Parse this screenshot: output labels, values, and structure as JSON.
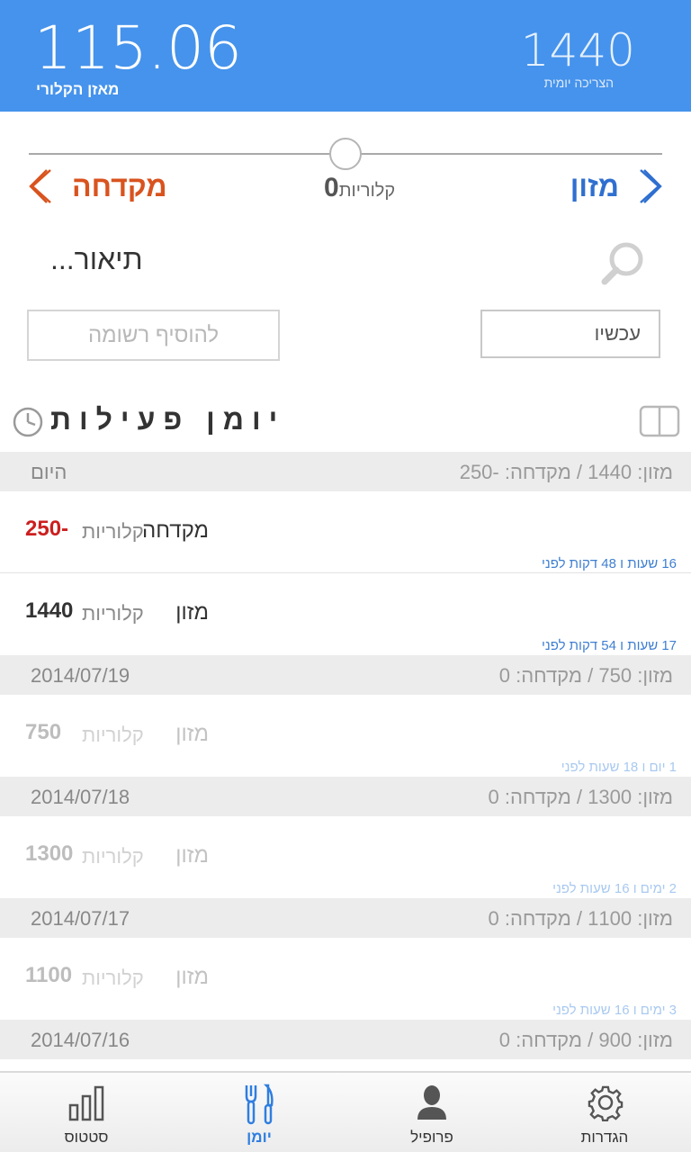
{
  "header": {
    "balance_value": "115.06",
    "balance_label": "מאזן הקלורי",
    "requirement_value": "1440",
    "requirement_label": "הצריכה יומית",
    "background_color": "#4593ec"
  },
  "entry_form": {
    "left_nav_label": "מקדחה",
    "right_nav_label": "מזון",
    "calories_value": "0",
    "calories_word": "קלוריות",
    "description_placeholder": "תיאור...",
    "add_note_label": "להוסיף רשומה",
    "time_value": "עכשיו"
  },
  "log": {
    "title": "יומן פעילות",
    "days": [
      {
        "summary": "מזון: 1440 / מקדחה: -250",
        "date": "היום",
        "entries": [
          {
            "type": "מקדחה",
            "cal_word": "קלוריות",
            "cal_value": "250-",
            "ago": "16 שעות ו 48 דקות לפני"
          },
          {
            "type": "מזון",
            "cal_word": "קלוריות",
            "cal_value": "1440",
            "ago": "17 שעות ו 54 דקות לפני"
          }
        ]
      },
      {
        "summary": "מזון: 750 / מקדחה: 0",
        "date": "2014/07/19",
        "entries": [
          {
            "type": "מזון",
            "cal_word": "קלוריות",
            "cal_value": "750",
            "ago": "1 יום ו 18 שעות לפני"
          }
        ]
      },
      {
        "summary": "מזון: 1300 / מקדחה: 0",
        "date": "2014/07/18",
        "entries": [
          {
            "type": "מזון",
            "cal_word": "קלוריות",
            "cal_value": "1300",
            "ago": "2 ימים ו 16 שעות לפני"
          }
        ]
      },
      {
        "summary": "מזון: 1100 / מקדחה: 0",
        "date": "2014/07/17",
        "entries": [
          {
            "type": "מזון",
            "cal_word": "קלוריות",
            "cal_value": "1100",
            "ago": "3 ימים ו 16 שעות לפני"
          }
        ]
      },
      {
        "summary": "מזון: 900 / מקדחה: 0",
        "date": "2014/07/16",
        "entries": []
      }
    ]
  },
  "tabbar": {
    "tabs": [
      {
        "label": "סטטוס",
        "icon": "bar-chart-icon",
        "active": false
      },
      {
        "label": "יומן",
        "icon": "fork-knife-icon",
        "active": true
      },
      {
        "label": "פרופיל",
        "icon": "person-icon",
        "active": false
      },
      {
        "label": "הגדרות",
        "icon": "gear-icon",
        "active": false
      }
    ],
    "active_color": "#2f7ee0"
  }
}
